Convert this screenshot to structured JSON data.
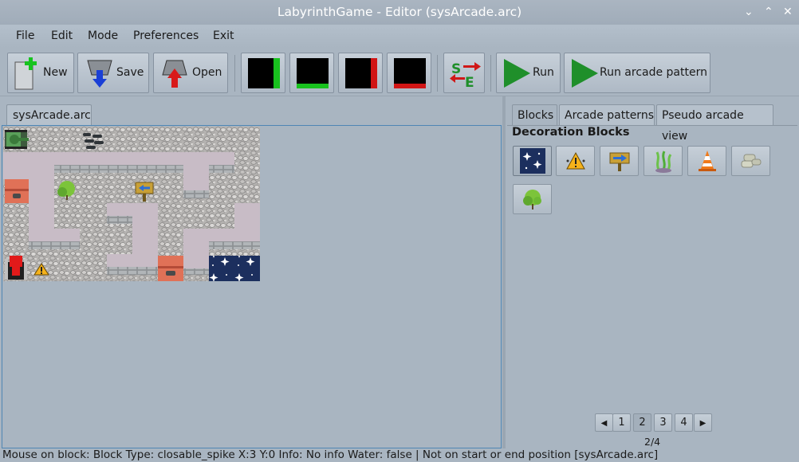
{
  "window": {
    "title": "LabyrinthGame - Editor (sysArcade.arc)"
  },
  "menu": [
    "File",
    "Edit",
    "Mode",
    "Preferences",
    "Exit"
  ],
  "toolbar": {
    "new_label": "New",
    "save_label": "Save",
    "open_label": "Open",
    "run_label": "Run",
    "run_pattern_label": "Run arcade pattern"
  },
  "editor": {
    "tab_label": "sysArcade.arc"
  },
  "right_panel": {
    "tabs": [
      "Blocks",
      "Arcade patterns",
      "Pseudo arcade view"
    ],
    "section_title": "Decoration Blocks",
    "blocks": [
      "stars-tile",
      "warning-sign",
      "arrow-signpost",
      "seaweed",
      "traffic-cone",
      "stones",
      "bush"
    ],
    "pagination": {
      "prev": "◀",
      "pages": [
        "1",
        "2",
        "3",
        "4"
      ],
      "next": "▶",
      "label": "2/4"
    }
  },
  "status": {
    "text": "Mouse on block: Block Type: closable_spike X:3 Y:0 Info: No info Water: false | Not on start or end position [sysArcade.arc]"
  },
  "colors": {
    "background": "#a9b5c1",
    "accent_green": "#1f8f2a",
    "accent_red": "#d01818",
    "floor": "#c8bcc6",
    "stone": "#8e8e8e",
    "stars_blue": "#1c2f5e"
  }
}
